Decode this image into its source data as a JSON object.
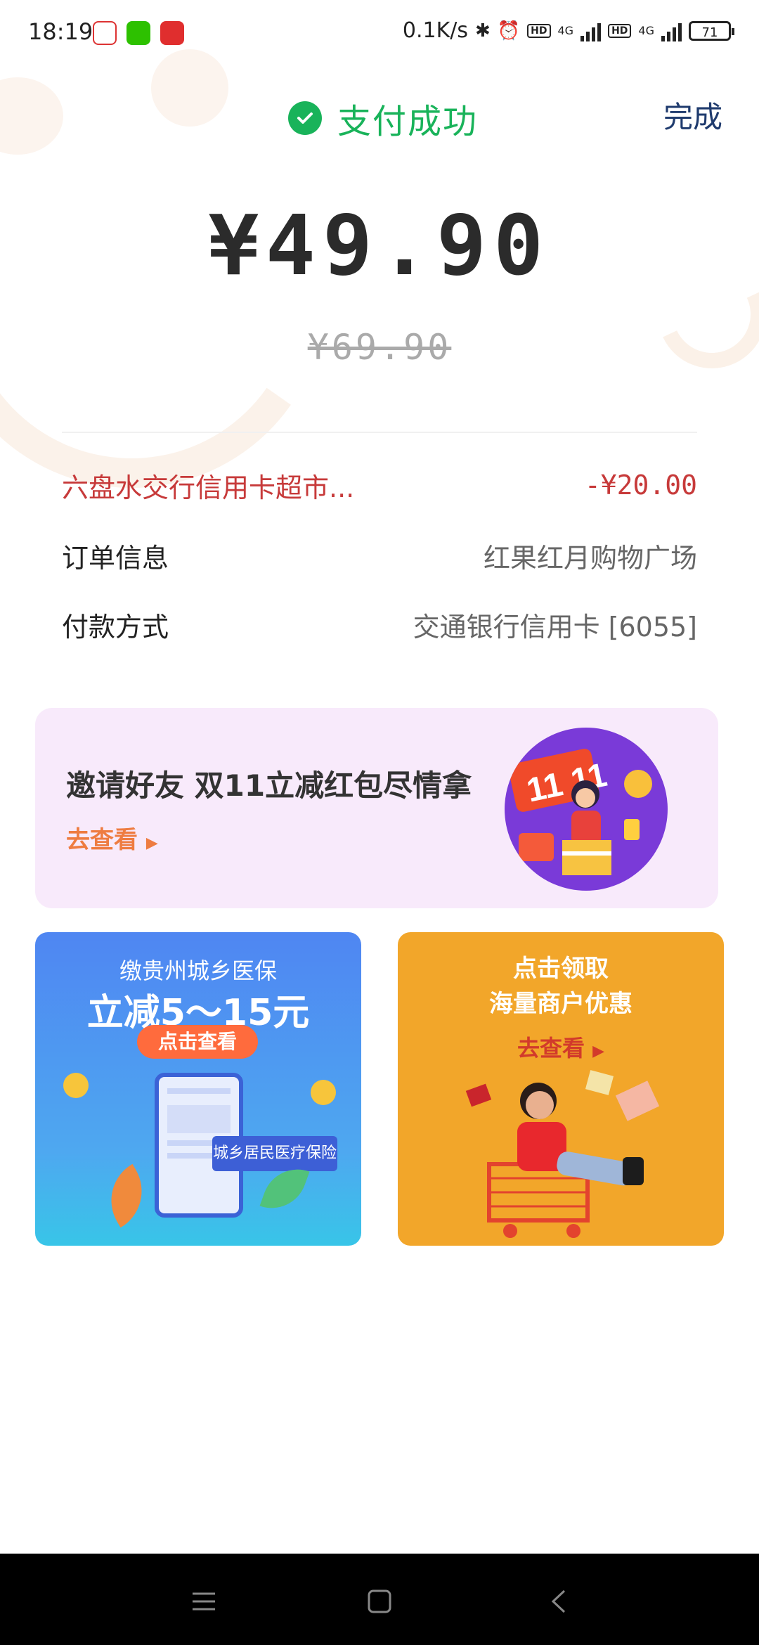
{
  "status_bar": {
    "time": "18:19",
    "net_speed": "0.1K/s",
    "net1": "4G",
    "net2": "4G",
    "hd": "HD",
    "battery": "71",
    "icons": [
      "app-notification-icon",
      "wechat-icon",
      "app-notification-icon",
      "bluetooth-icon",
      "alarm-icon"
    ]
  },
  "header": {
    "status": "支付成功",
    "done": "完成",
    "success_color": "#19b35a"
  },
  "payment": {
    "amount": "¥49.90",
    "original_amount": "¥69.90"
  },
  "details": {
    "discount_label": "六盘水交行信用卡超市...",
    "discount_value": "-¥20.00",
    "order_label": "订单信息",
    "order_value": "红果红月购物广场",
    "method_label": "付款方式",
    "method_value": "交通银行信用卡 [6055]"
  },
  "invite": {
    "title": "邀请好友 双11立减红包尽情拿",
    "link": "去查看",
    "art_text": "11 11"
  },
  "card_left": {
    "subtitle": "缴贵州城乡医保",
    "headline": "立减5～15元",
    "button": "点击查看",
    "tag": "城乡居民医疗保险"
  },
  "card_right": {
    "line1": "点击领取",
    "line2": "海量商户优惠",
    "link": "去查看"
  }
}
